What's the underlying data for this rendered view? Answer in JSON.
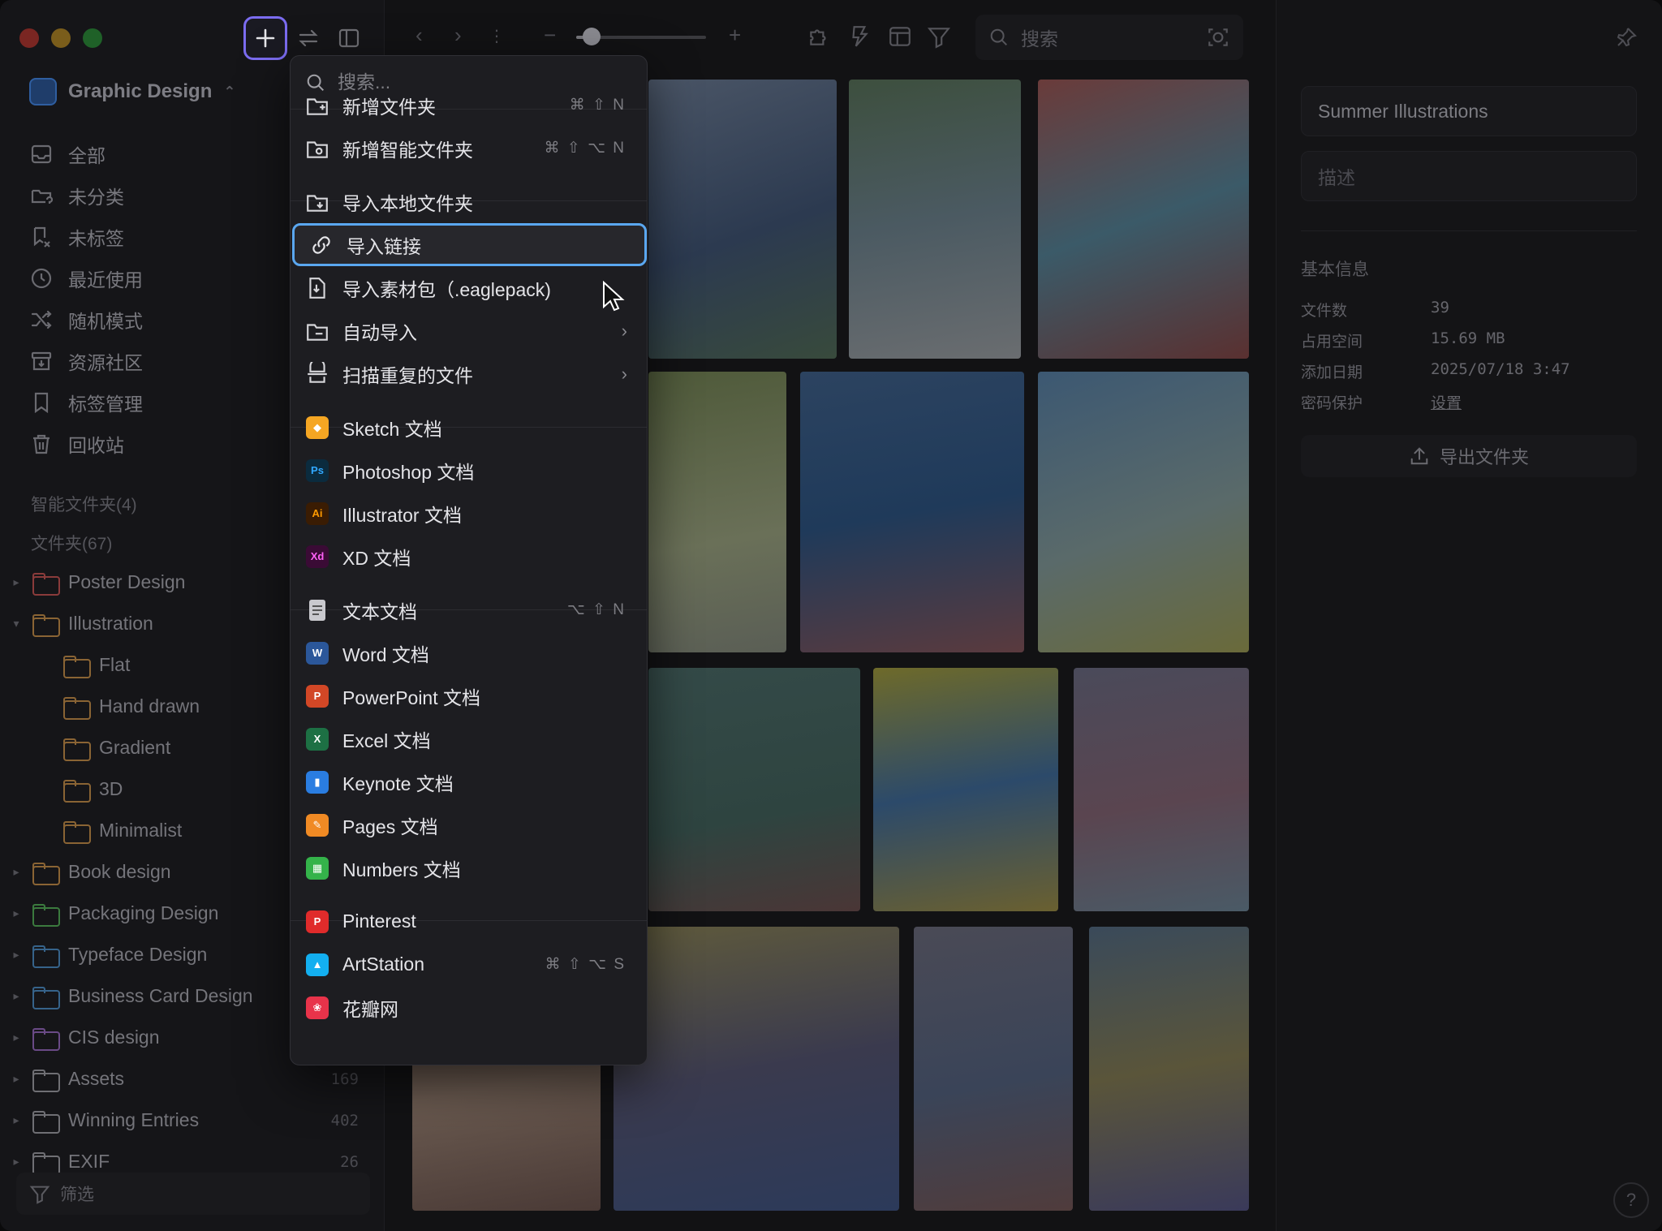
{
  "sidebar": {
    "library_name": "Graphic Design",
    "nav": [
      {
        "label": "全部",
        "icon": "inbox-icon"
      },
      {
        "label": "未分类",
        "icon": "folder-question-icon"
      },
      {
        "label": "未标签",
        "icon": "tag-off-icon"
      },
      {
        "label": "最近使用",
        "icon": "clock-icon"
      },
      {
        "label": "随机模式",
        "icon": "shuffle-icon"
      },
      {
        "label": "资源社区",
        "icon": "community-icon"
      },
      {
        "label": "标签管理",
        "icon": "bookmark-icon"
      },
      {
        "label": "回收站",
        "icon": "trash-icon"
      }
    ],
    "smart_folders_header": "智能文件夹(4)",
    "folders_header": "文件夹(67)",
    "folders": [
      {
        "label": "Poster Design",
        "color": "#8a3b3b",
        "count": "",
        "expanded": false
      },
      {
        "label": "Illustration",
        "color": "#8a6434",
        "count": "",
        "expanded": true
      },
      {
        "label": "Flat",
        "color": "#8a6434",
        "count": "",
        "child": true
      },
      {
        "label": "Hand drawn",
        "color": "#8a6434",
        "count": "",
        "child": true
      },
      {
        "label": "Gradient",
        "color": "#8a6434",
        "count": "",
        "child": true
      },
      {
        "label": "3D",
        "color": "#8a6434",
        "count": "",
        "child": true
      },
      {
        "label": "Minimalist",
        "color": "#8a6434",
        "count": "",
        "child": true
      },
      {
        "label": "Book design",
        "color": "#8a6434",
        "count": ""
      },
      {
        "label": "Packaging Design",
        "color": "#3b7a3e",
        "count": ""
      },
      {
        "label": "Typeface Design",
        "color": "#36638a",
        "count": ""
      },
      {
        "label": "Business Card Design",
        "color": "#36638a",
        "count": ""
      },
      {
        "label": "CIS design",
        "color": "#6a4a86",
        "count": ""
      },
      {
        "label": "Assets",
        "color": "#6f6f74",
        "count": "169"
      },
      {
        "label": "Winning Entries",
        "color": "#6f6f74",
        "count": "402"
      },
      {
        "label": "EXIF",
        "color": "#6f6f74",
        "count": "26"
      }
    ],
    "filter_label": "筛选"
  },
  "toolbar": {
    "search_placeholder": "搜索",
    "zoom_level": 0.12
  },
  "menu": {
    "search_placeholder": "搜索...",
    "items": [
      {
        "label": "新增文件夹",
        "shortcut": "⌘ ⇧ N",
        "icon": "folder-plus-icon"
      },
      {
        "label": "新增智能文件夹",
        "shortcut": "⌘ ⇧ ⌥ N",
        "icon": "smart-folder-icon"
      },
      {
        "label": "导入本地文件夹",
        "shortcut": "",
        "icon": "folder-import-icon"
      },
      {
        "label": "导入链接",
        "shortcut": "",
        "icon": "link-icon",
        "active": true
      },
      {
        "label": "导入素材包（.eaglepack)",
        "shortcut": "",
        "icon": "package-icon"
      },
      {
        "label": "自动导入",
        "shortcut": "",
        "icon": "auto-import-icon",
        "submenu": true
      },
      {
        "label": "扫描重复的文件",
        "shortcut": "",
        "icon": "duplicate-scan-icon",
        "submenu": true
      },
      {
        "label": "Sketch 文档",
        "shortcut": "",
        "icon": "sketch-icon"
      },
      {
        "label": "Photoshop 文档",
        "shortcut": "",
        "icon": "photoshop-icon"
      },
      {
        "label": "Illustrator 文档",
        "shortcut": "",
        "icon": "illustrator-icon"
      },
      {
        "label": "XD 文档",
        "shortcut": "",
        "icon": "xd-icon"
      },
      {
        "label": "文本文档",
        "shortcut": "⌥ ⇧ N",
        "icon": "text-doc-icon"
      },
      {
        "label": "Word 文档",
        "shortcut": "",
        "icon": "word-icon"
      },
      {
        "label": "PowerPoint 文档",
        "shortcut": "",
        "icon": "powerpoint-icon"
      },
      {
        "label": "Excel 文档",
        "shortcut": "",
        "icon": "excel-icon"
      },
      {
        "label": "Keynote 文档",
        "shortcut": "",
        "icon": "keynote-icon"
      },
      {
        "label": "Pages 文档",
        "shortcut": "",
        "icon": "pages-icon"
      },
      {
        "label": "Numbers 文档",
        "shortcut": "",
        "icon": "numbers-icon"
      },
      {
        "label": "Pinterest",
        "shortcut": "",
        "icon": "pinterest-icon"
      },
      {
        "label": "ArtStation",
        "shortcut": "⌘ ⇧ ⌥ S",
        "icon": "artstation-icon"
      },
      {
        "label": "花瓣网",
        "shortcut": "",
        "icon": "huaban-icon"
      }
    ],
    "app_badges": {
      "photoshop": "Ps",
      "illustrator": "Ai",
      "xd": "Xd",
      "word": "W",
      "powerpoint": "P",
      "excel": "X"
    }
  },
  "inspector": {
    "title_value": "Summer Illustrations",
    "desc_placeholder": "描述",
    "info_header": "基本信息",
    "info": [
      {
        "key": "文件数",
        "value": "39"
      },
      {
        "key": "占用空间",
        "value": "15.69 MB"
      },
      {
        "key": "添加日期",
        "value": "2025/07/18 3:47"
      },
      {
        "key": "密码保护",
        "value": "设置",
        "link": true
      }
    ],
    "export_label": "导出文件夹",
    "help_label": "?"
  },
  "colors": {
    "accent": "#7b6cf0",
    "active_border": "#5aa7f0"
  }
}
